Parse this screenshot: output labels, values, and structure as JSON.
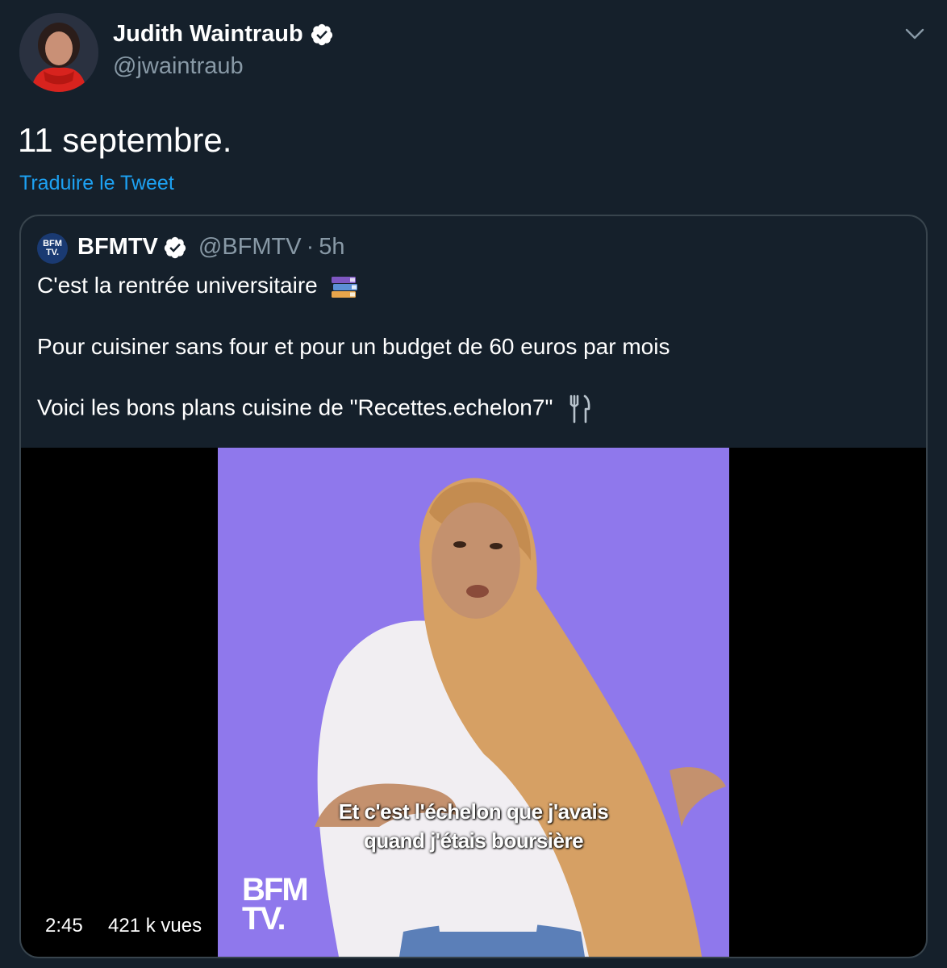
{
  "author": {
    "name": "Judith Waintraub",
    "handle": "@jwaintraub"
  },
  "tweet": {
    "text": "11 septembre.",
    "translate_link": "Traduire le Tweet"
  },
  "quoted": {
    "logo_text_1": "BFM",
    "logo_text_2": "TV.",
    "name": "BFMTV",
    "handle": "@BFMTV",
    "separator": "·",
    "time": "5h",
    "line1": "C'est la rentrée universitaire",
    "line2": "Pour cuisiner sans four et pour un budget de 60 euros par mois",
    "line3": "Voici les bons plans cuisine de \"Recettes.echelon7\"",
    "video": {
      "subtitle_1": "Et c'est l'échelon que j'avais",
      "subtitle_2": "quand j'étais boursière",
      "watermark_1": "BFM",
      "watermark_2": "TV.",
      "duration": "2:45",
      "views": "421 k vues"
    }
  },
  "icons": [
    "verified-badge-icon",
    "chevron-down-icon",
    "books-icon",
    "fork-knife-icon"
  ],
  "colors": {
    "background": "#15202b",
    "link": "#1da1f2",
    "secondary_text": "#8899a6",
    "border": "#38444d",
    "video_backdrop": "#8f78ec"
  }
}
